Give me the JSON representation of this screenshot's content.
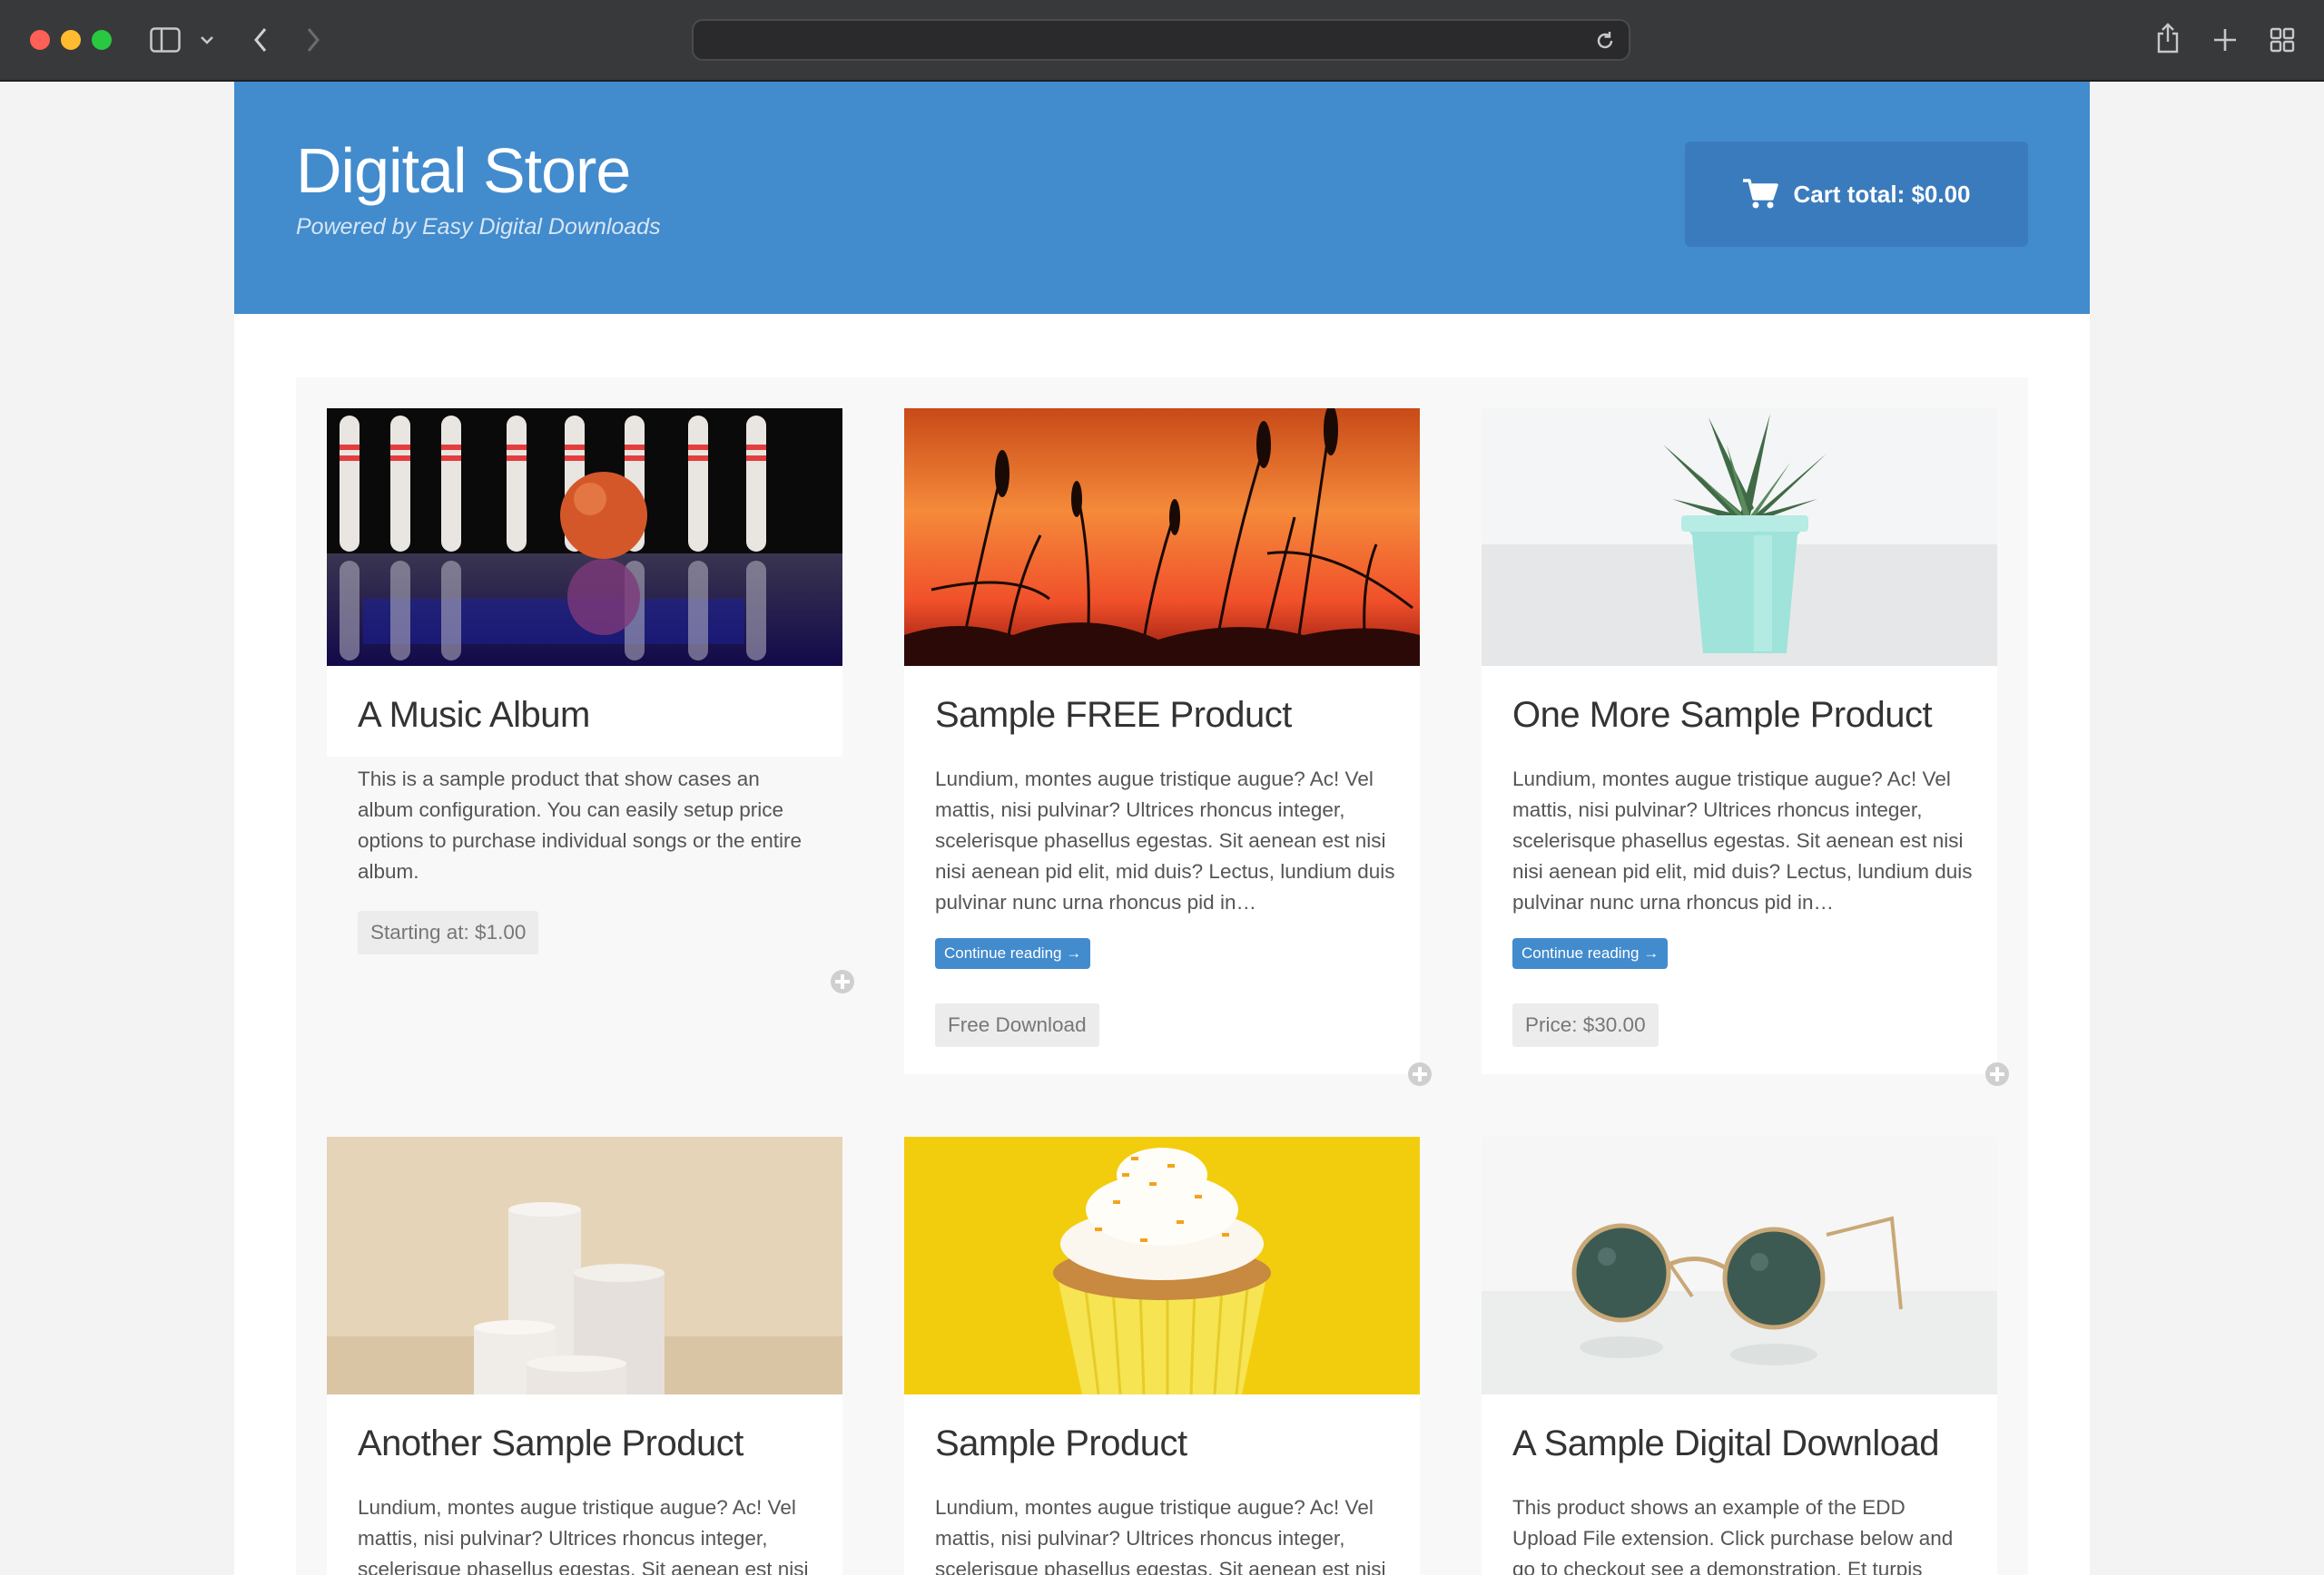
{
  "site": {
    "title": "Digital Store",
    "tagline": "Powered by Easy Digital Downloads",
    "cart_label": "Cart total: $0.00",
    "accent_color": "#428bcd"
  },
  "browser": {
    "url": "",
    "icons": [
      "sidebar-icon",
      "chevron-down-icon",
      "back-icon",
      "forward-icon",
      "reload-icon",
      "share-icon",
      "new-tab-icon",
      "tab-overview-icon"
    ]
  },
  "products": [
    {
      "title": "A Music Album",
      "excerpt": "This is a sample product that show cases an album configuration. You can easily setup price options to purchase individual songs or the entire album.",
      "price": "Starting at: $1.00",
      "image": "bowling-pins"
    },
    {
      "title": "Sample FREE Product",
      "excerpt": "Lundium, montes augue tristique augue? Ac! Vel mattis, nisi pulvinar? Ultrices rhoncus integer, scelerisque phasellus egestas. Sit aenean est nisi nisi aenean pid elit, mid duis? Lectus, lundium duis pulvinar nunc urna rhoncus pid in…",
      "continue": "Continue reading →",
      "price": "Free Download",
      "image": "sunset-grass"
    },
    {
      "title": "One More Sample Product",
      "excerpt": "Lundium, montes augue tristique augue? Ac! Vel mattis, nisi pulvinar? Ultrices rhoncus integer, scelerisque phasellus egestas. Sit aenean est nisi nisi aenean pid elit, mid duis? Lectus, lundium duis pulvinar nunc urna rhoncus pid in…",
      "continue": "Continue reading →",
      "price": "Price: $30.00",
      "image": "succulent-pot"
    },
    {
      "title": "Another Sample Product",
      "excerpt": "Lundium, montes augue tristique augue? Ac! Vel mattis, nisi pulvinar? Ultrices rhoncus integer, scelerisque phasellus egestas. Sit aenean est nisi",
      "image": "pedestals"
    },
    {
      "title": "Sample Product",
      "excerpt": "Lundium, montes augue tristique augue? Ac! Vel mattis, nisi pulvinar? Ultrices rhoncus integer, scelerisque phasellus egestas. Sit aenean est nisi",
      "image": "cupcake"
    },
    {
      "title": "A Sample Digital Download",
      "excerpt": "This product shows an example of the EDD Upload File extension. Click purchase below and go to checkout see a demonstration. Et turpis",
      "image": "sunglasses"
    }
  ]
}
